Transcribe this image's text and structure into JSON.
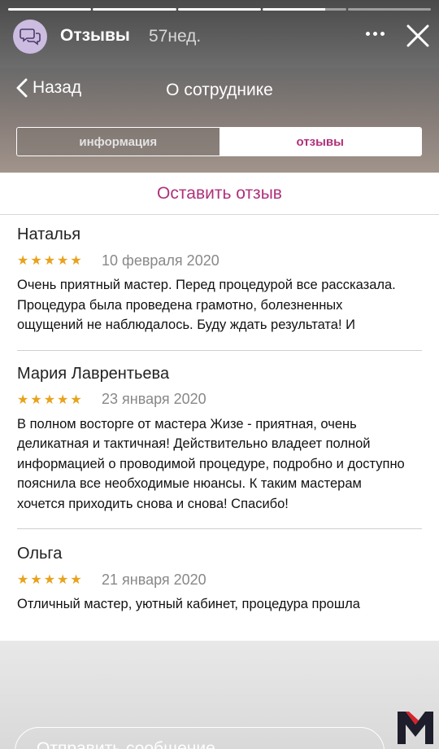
{
  "story": {
    "title": "Отзывы",
    "time": "57нед."
  },
  "header": {
    "back_label": "Назад",
    "title": "О сотруднике"
  },
  "tabs": [
    {
      "label": "информация",
      "active": false
    },
    {
      "label": "отзывы",
      "active": true
    }
  ],
  "leave_review_label": "Оставить отзыв",
  "reviews": [
    {
      "name": "Наталья",
      "stars": "★★★★★",
      "rating": 5,
      "date": "10 февраля 2020",
      "text": "Очень приятный мастер. Перед процедурой все рассказала. Процедура была проведена грамотно, болезненных ощущений не наблюдалось. Буду ждать результата! И"
    },
    {
      "name": "Мария Лаврентьева",
      "stars": "★★★★★",
      "rating": 5,
      "date": "23 января 2020",
      "text": "В полном восторге от мастера Жизе - приятная, очень деликатная и тактичная! Действительно владеет полной информацией о проводимой процедуре, подробно и доступно пояснила все необходимые нюансы. К таким мастерам хочется приходить снова и снова! Спасибо!"
    },
    {
      "name": "Ольга",
      "stars": "★★★★★",
      "rating": 5,
      "date": "21 января 2020",
      "text": "Отличный мастер, уютный кабинет, процедура прошла"
    }
  ],
  "reply": {
    "placeholder": "Отправить сообщение"
  },
  "colors": {
    "accent": "#b0307a",
    "star": "#e8a21c"
  },
  "icons": {
    "avatar": "chat-bubbles-icon",
    "more": "more-dots-icon",
    "close": "close-icon",
    "back": "chevron-left-icon",
    "watermark": "m-logo"
  }
}
